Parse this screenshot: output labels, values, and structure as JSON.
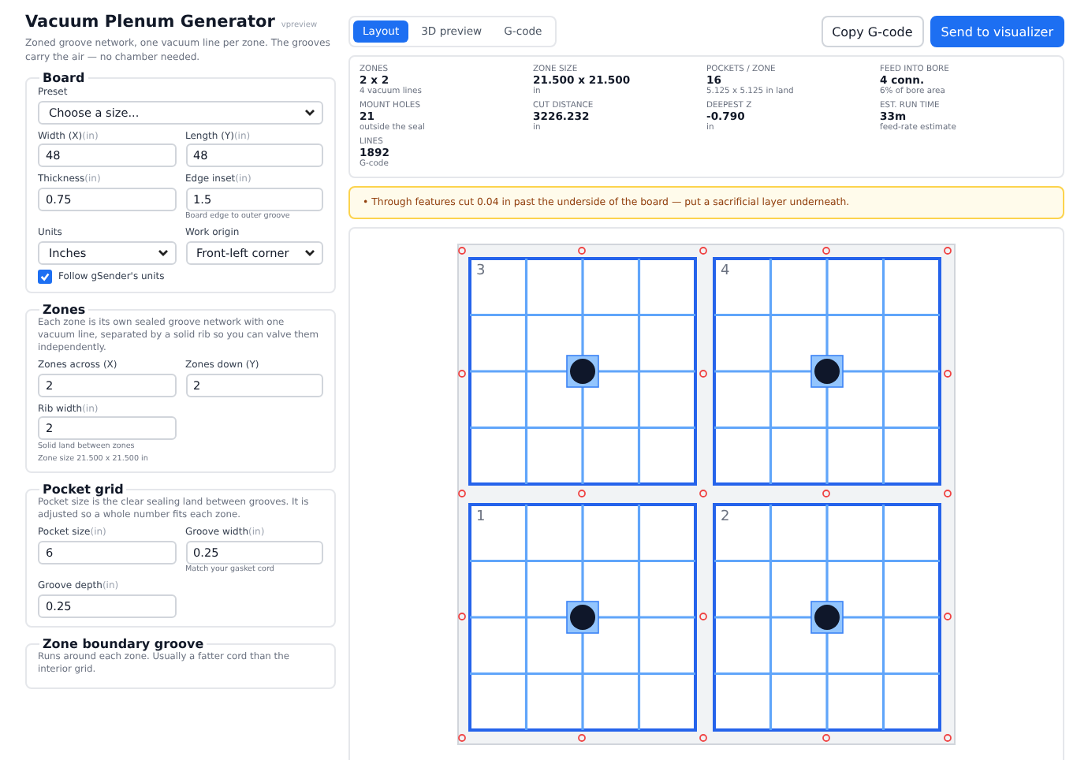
{
  "app": {
    "title": "Vacuum Plenum Generator",
    "version": "vpreview",
    "description": "Zoned groove network, one vacuum line per zone. The grooves carry the air — no chamber needed."
  },
  "sections": [
    {
      "title": "Board",
      "fields": [
        {
          "kind": "select",
          "label": "Preset",
          "value": "Choose a size...",
          "wide": true
        },
        {
          "kind": "input",
          "label": "Width (X)",
          "unit": "(in)",
          "value": "48"
        },
        {
          "kind": "input",
          "label": "Length (Y)",
          "unit": "(in)",
          "value": "48"
        },
        {
          "kind": "input",
          "label": "Thickness",
          "unit": "(in)",
          "value": "0.75"
        },
        {
          "kind": "input",
          "label": "Edge inset",
          "unit": "(in)",
          "value": "1.5",
          "hint": "Board edge to outer groove"
        },
        {
          "kind": "select",
          "label": "Units",
          "value": "Inches"
        },
        {
          "kind": "select",
          "label": "Work origin",
          "value": "Front-left corner"
        }
      ],
      "checkbox": {
        "label": "Follow gSender's units",
        "checked": true
      }
    },
    {
      "title": "Zones",
      "intro": "Each zone is its own sealed groove network with one vacuum line, separated by a solid rib so you can valve them independently.",
      "fields": [
        {
          "kind": "input",
          "label": "Zones across (X)",
          "value": "2"
        },
        {
          "kind": "input",
          "label": "Zones down (Y)",
          "value": "2"
        },
        {
          "kind": "input",
          "label": "Rib width",
          "unit": "(in)",
          "value": "2",
          "hint": "Solid land between zones"
        }
      ],
      "note": "Zone size 21.500 x 21.500 in"
    },
    {
      "title": "Pocket grid",
      "intro": "Pocket size is the clear sealing land between grooves. It is adjusted so a whole number fits each zone.",
      "fields": [
        {
          "kind": "input",
          "label": "Pocket size",
          "unit": "(in)",
          "value": "6"
        },
        {
          "kind": "input",
          "label": "Groove width",
          "unit": "(in)",
          "value": "0.25",
          "hint": "Match your gasket cord"
        },
        {
          "kind": "input",
          "label": "Groove depth",
          "unit": "(in)",
          "value": "0.25"
        }
      ]
    },
    {
      "title": "Zone boundary groove",
      "intro": "Runs around each zone. Usually a fatter cord than the interior grid."
    }
  ],
  "tabs": [
    {
      "label": "Layout",
      "selected": true
    },
    {
      "label": "3D preview",
      "selected": false
    },
    {
      "label": "G-code",
      "selected": false
    }
  ],
  "buttons": [
    {
      "label": "Copy G-code",
      "kind": "secondary"
    },
    {
      "label": "Send to visualizer",
      "kind": "primary"
    }
  ],
  "stats": [
    {
      "label": "ZONES",
      "value": "2 x 2",
      "sub": "4 vacuum lines"
    },
    {
      "label": "ZONE SIZE",
      "value": "21.500 x 21.500",
      "sub": "in"
    },
    {
      "label": "POCKETS / ZONE",
      "value": "16",
      "sub": "5.125 x 5.125 in land"
    },
    {
      "label": "FEED INTO BORE",
      "value": "4 conn.",
      "sub": "6% of bore area"
    },
    {
      "label": "MOUNT HOLES",
      "value": "21",
      "sub": "outside the seal"
    },
    {
      "label": "CUT DISTANCE",
      "value": "3226.232",
      "sub": "in"
    },
    {
      "label": "DEEPEST Z",
      "value": "-0.790",
      "sub": "in"
    },
    {
      "label": "EST. RUN TIME",
      "value": "33m",
      "sub": "feed-rate estimate"
    },
    {
      "label": "LINES",
      "value": "1892",
      "sub": "G-code"
    }
  ],
  "warning": "• Through features cut 0.04 in past the underside of the board — put a sacrificial layer underneath.",
  "zones": [
    {
      "label": "3"
    },
    {
      "label": "4"
    },
    {
      "label": "1"
    },
    {
      "label": "2"
    }
  ]
}
